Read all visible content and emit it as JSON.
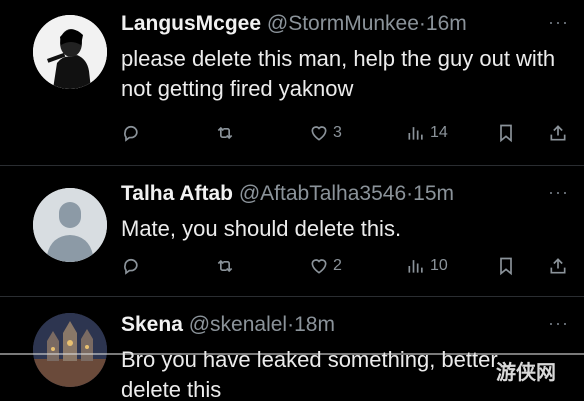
{
  "replies": [
    {
      "name": "LangusMcgee",
      "handle": "@StormMunkee",
      "time": "16m",
      "text": "please delete this man, help the guy out with not getting fired yaknow",
      "likes": "3",
      "views": "14"
    },
    {
      "name": "Talha Aftab",
      "handle": "@AftabTalha3546",
      "time": "15m",
      "text": "Mate, you should delete this.",
      "likes": "2",
      "views": "10"
    },
    {
      "name": "Skena",
      "handle": "@skenalel",
      "time": "18m",
      "text": "Bro you have leaked something, better delete this"
    }
  ],
  "separator": "·",
  "more": "···",
  "watermark": "游侠网",
  "colors": {
    "background": "#000000",
    "text": "#e7e9ea",
    "secondary": "#8b939a"
  }
}
